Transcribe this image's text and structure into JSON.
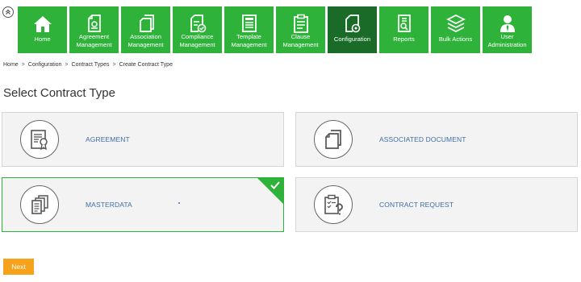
{
  "nav": {
    "items": [
      {
        "label": "Home",
        "icon": "home-icon"
      },
      {
        "label": "Agreement Management",
        "icon": "agreement-icon"
      },
      {
        "label": "Association Management",
        "icon": "documents-icon"
      },
      {
        "label": "Compliance Management",
        "icon": "compliance-icon"
      },
      {
        "label": "Template Management",
        "icon": "template-icon"
      },
      {
        "label": "Clause Management",
        "icon": "clipboard-icon"
      },
      {
        "label": "Configuration",
        "icon": "configuration-icon"
      },
      {
        "label": "Reports",
        "icon": "reports-icon"
      },
      {
        "label": "Bulk Actions",
        "icon": "layers-icon"
      },
      {
        "label": "User Administration",
        "icon": "user-icon"
      }
    ],
    "active": "Configuration"
  },
  "breadcrumb": {
    "items": [
      "Home",
      "Configuration",
      "Contract Types",
      "Create Contract Type"
    ],
    "separator": ">"
  },
  "page": {
    "title": "Select Contract Type"
  },
  "contract_types": [
    {
      "label": "AGREEMENT",
      "icon": "certificate-document-icon",
      "selected": false
    },
    {
      "label": "ASSOCIATED DOCUMENT",
      "icon": "documents-icon",
      "selected": false
    },
    {
      "label": "MASTERDATA",
      "icon": "stacked-documents-icon",
      "selected": true
    },
    {
      "label": "CONTRACT REQUEST",
      "icon": "clipboard-question-icon",
      "selected": false
    }
  ],
  "actions": {
    "next_label": "Next"
  },
  "colors": {
    "nav_green": "#2fb23a",
    "nav_active": "#1a6b28",
    "card_label_blue": "#3f6ea5",
    "next_orange": "#f7a21b",
    "selected_border": "#2fb23a"
  }
}
